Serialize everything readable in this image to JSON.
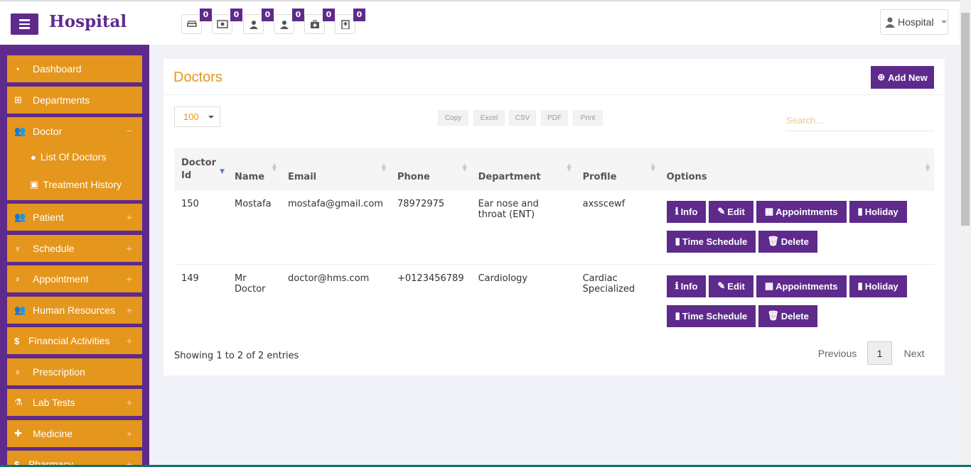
{
  "header": {
    "brand": "Hospital",
    "user_label": "Hospital",
    "notifications": [
      {
        "icon": "bed-icon",
        "count": "0"
      },
      {
        "icon": "money-icon",
        "count": "0"
      },
      {
        "icon": "user-icon",
        "count": "0"
      },
      {
        "icon": "user-icon",
        "count": "0"
      },
      {
        "icon": "medkit-icon",
        "count": "0"
      },
      {
        "icon": "hospital-icon",
        "count": "0"
      }
    ]
  },
  "sidebar": {
    "items": [
      {
        "label": "Dashboard",
        "icon": "dashboard-icon"
      },
      {
        "label": "Departments",
        "icon": "sitemap-icon"
      },
      {
        "label": "Doctor",
        "icon": "users-icon",
        "expanded": true
      },
      {
        "label": "List Of Doctors",
        "icon": "user-icon"
      },
      {
        "label": "Treatment History",
        "icon": "money-icon"
      },
      {
        "label": "Patient",
        "icon": "users-icon"
      },
      {
        "label": "Schedule",
        "icon": "stethoscope-icon"
      },
      {
        "label": "Appointment",
        "icon": "stethoscope-icon"
      },
      {
        "label": "Human Resources",
        "icon": "users-icon"
      },
      {
        "label": "Financial Activities",
        "icon": "dollar-icon"
      },
      {
        "label": "Prescription",
        "icon": "stethoscope-icon"
      },
      {
        "label": "Lab Tests",
        "icon": "flask-icon"
      },
      {
        "label": "Medicine",
        "icon": "medkit-icon"
      },
      {
        "label": "Pharmacy",
        "icon": "dollar-icon"
      }
    ],
    "expand_symbol": "+",
    "collapse_symbol": "−"
  },
  "panel": {
    "title": "Doctors",
    "add_button": "Add New",
    "page_size": "100",
    "export_buttons": [
      "Copy",
      "Excel",
      "CSV",
      "PDF",
      "Print"
    ],
    "search_placeholder": "Search..."
  },
  "table": {
    "headers": [
      "Doctor Id",
      "Name",
      "Email",
      "Phone",
      "Department",
      "Profile",
      "Options"
    ],
    "rows": [
      {
        "id": "150",
        "name": "Mostafa",
        "email": "mostafa@gmail.com",
        "phone": "78972975",
        "department": "Ear nose and throat (ENT)",
        "profile": "axsscewf"
      },
      {
        "id": "149",
        "name": "Mr Doctor",
        "email": "doctor@hms.com",
        "phone": "+0123456789",
        "department": "Cardiology",
        "profile": "Cardiac Specialized"
      }
    ],
    "option_buttons": [
      "Info",
      "Edit",
      "Appointments",
      "Holiday",
      "Time Schedule",
      "Delete"
    ]
  },
  "footer": {
    "info": "Showing 1 to 2 of 2 entries",
    "previous": "Previous",
    "page": "1",
    "next": "Next"
  },
  "colors": {
    "primary": "#5e2a8c",
    "accent": "#e4961d"
  }
}
